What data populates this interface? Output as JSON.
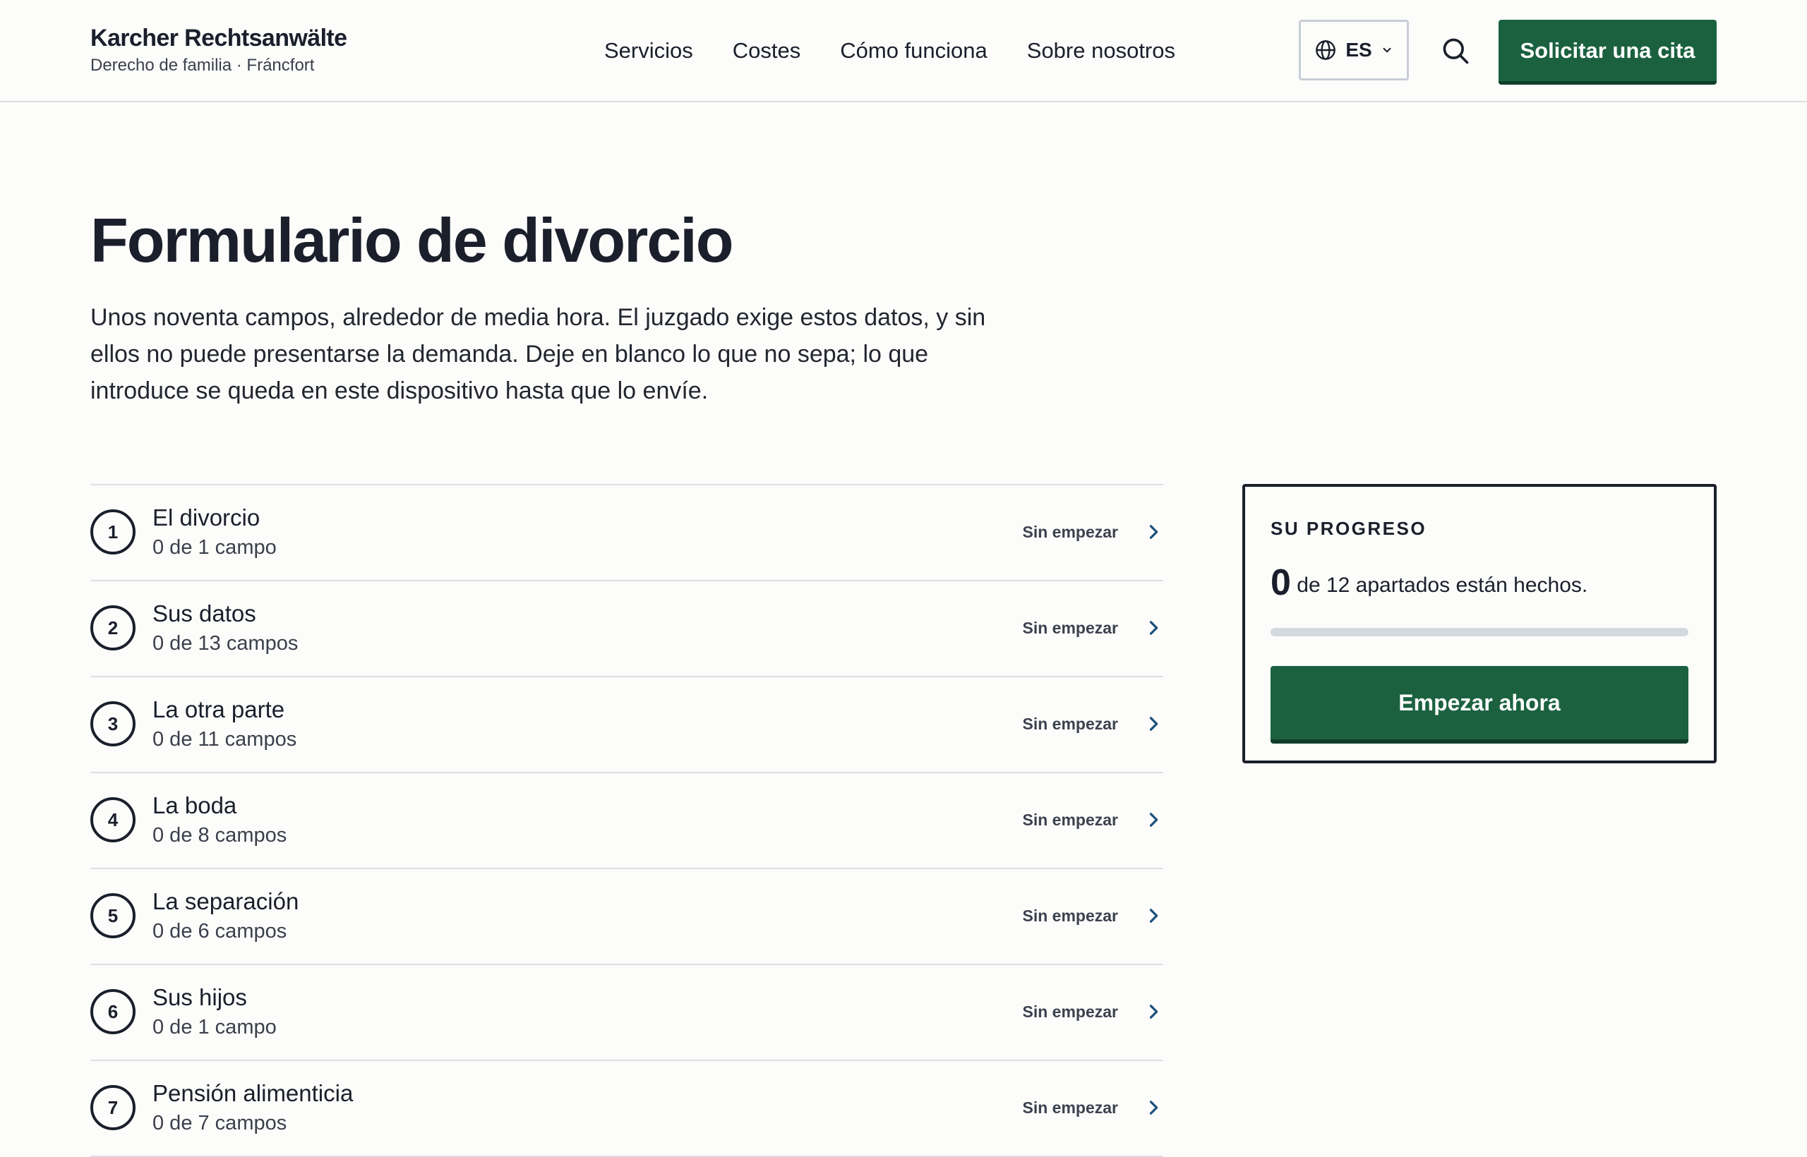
{
  "header": {
    "brand_name": "Karcher Rechtsanwälte",
    "brand_sub": "Derecho de familia · Fráncfort",
    "nav": [
      "Servicios",
      "Costes",
      "Cómo funciona",
      "Sobre nosotros"
    ],
    "lang": "ES",
    "cta": "Solicitar una cita",
    "icons": {
      "lang": "globe-icon",
      "lang_caret": "chevron-down-icon",
      "search": "search-icon"
    }
  },
  "hero": {
    "title": "Formulario de divorcio",
    "intro": "Unos noventa campos, alrededor de media hora. El juzgado exige estos datos, y sin ellos no puede presentarse la demanda. Deje en blanco lo que no sepa; lo que introduce se queda en este dispositivo hasta que lo envíe."
  },
  "sections": [
    {
      "number": "1",
      "title": "El divorcio",
      "count": "0 de 1 campo",
      "status": "Sin empezar"
    },
    {
      "number": "2",
      "title": "Sus datos",
      "count": "0 de 13 campos",
      "status": "Sin empezar"
    },
    {
      "number": "3",
      "title": "La otra parte",
      "count": "0 de 11 campos",
      "status": "Sin empezar"
    },
    {
      "number": "4",
      "title": "La boda",
      "count": "0 de 8 campos",
      "status": "Sin empezar"
    },
    {
      "number": "5",
      "title": "La separación",
      "count": "0 de 6 campos",
      "status": "Sin empezar"
    },
    {
      "number": "6",
      "title": "Sus hijos",
      "count": "0 de 1 campo",
      "status": "Sin empezar"
    },
    {
      "number": "7",
      "title": "Pensión alimenticia",
      "count": "0 de 7 campos",
      "status": "Sin empezar"
    }
  ],
  "progress": {
    "label": "SU PROGRESO",
    "done": "0",
    "status_text": "de 12 apartados están hechos.",
    "fraction": 0,
    "button": "Empezar ahora"
  },
  "colors": {
    "accent": "#1b6140",
    "text": "#1a1f2b",
    "chevron": "#1f4f80",
    "background": "#fcfcfa"
  }
}
